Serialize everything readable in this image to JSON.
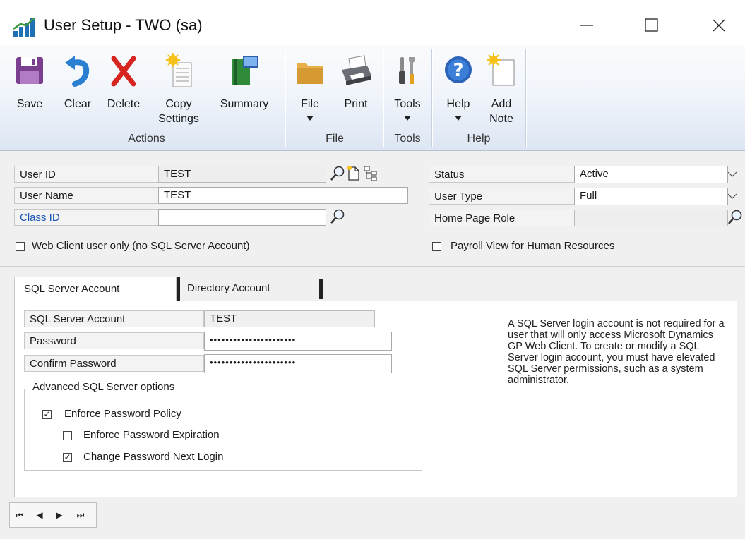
{
  "window": {
    "title": "User Setup  -  TWO (sa)",
    "icon": "dynamics-gp-chart-icon",
    "controls": [
      "minimize-icon",
      "maximize-icon",
      "close-icon"
    ]
  },
  "ribbon": {
    "groups": [
      {
        "label": "Actions",
        "buttons": [
          {
            "label": "Save",
            "icon": "floppy-disk-icon"
          },
          {
            "label": "Clear",
            "icon": "undo-arrow-icon"
          },
          {
            "label": "Delete",
            "icon": "red-x-icon"
          },
          {
            "label": "Copy",
            "label2": "Settings",
            "icon": "copy-settings-icon"
          },
          {
            "label": "Summary",
            "icon": "summary-book-icon"
          }
        ]
      },
      {
        "label": "File",
        "buttons": [
          {
            "label": "File",
            "icon": "folder-icon",
            "dropdown": true
          },
          {
            "label": "Print",
            "icon": "printer-icon"
          }
        ]
      },
      {
        "label": "Tools",
        "buttons": [
          {
            "label": "Tools",
            "icon": "tools-icon",
            "dropdown": true
          }
        ]
      },
      {
        "label": "Help",
        "buttons": [
          {
            "label": "Help",
            "icon": "help-icon",
            "dropdown": true
          },
          {
            "label": "Add",
            "label2": "Note",
            "icon": "add-note-icon"
          }
        ]
      }
    ]
  },
  "form": {
    "user_id": {
      "label": "User ID",
      "value": "TEST"
    },
    "user_name": {
      "label": "User Name",
      "value": "TEST"
    },
    "class_id": {
      "label": "Class ID",
      "value": ""
    },
    "web_client_only": {
      "label": "Web Client user only (no SQL Server Account)",
      "checked": false
    },
    "status": {
      "label": "Status",
      "value": "Active"
    },
    "user_type": {
      "label": "User Type",
      "value": "Full"
    },
    "home_page_role": {
      "label": "Home Page Role",
      "value": ""
    },
    "payroll_view": {
      "label": "Payroll View for Human Resources",
      "checked": false
    }
  },
  "tabs": [
    {
      "label": "SQL Server Account",
      "active": true
    },
    {
      "label": "Directory Account",
      "active": false
    }
  ],
  "sql_account": {
    "account": {
      "label": "SQL Server Account",
      "value": "TEST"
    },
    "password": {
      "label": "Password",
      "value": "••••••••••••••••••••••"
    },
    "confirm_password": {
      "label": "Confirm Password",
      "value": "••••••••••••••••••••••"
    },
    "advanced": {
      "title": "Advanced SQL Server options",
      "enforce_policy": {
        "label": "Enforce Password Policy",
        "checked": true
      },
      "enforce_expiration": {
        "label": "Enforce Password Expiration",
        "checked": false
      },
      "change_next_login": {
        "label": "Change Password Next Login",
        "checked": true
      }
    },
    "info": "A SQL Server login account is not required for a user that will only access Microsoft Dynamics GP Web Client. To create or modify a SQL Server login account, you must have elevated SQL Server permissions, such as a system administrator."
  },
  "nav": {
    "first": "⏮",
    "prev": "◀",
    "next": "▶",
    "last": "⏭"
  },
  "check_mark": "✓"
}
